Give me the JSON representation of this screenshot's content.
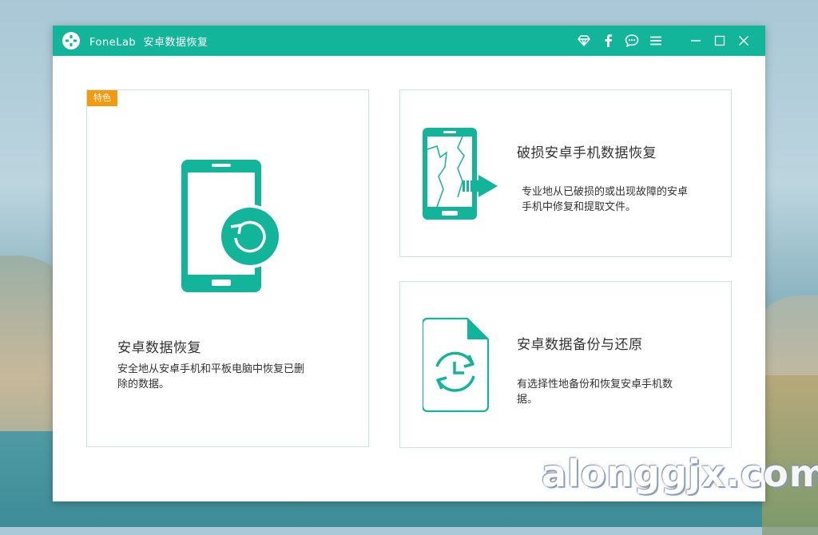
{
  "window": {
    "app_name": "FoneLab",
    "app_subtitle": "安卓数据恢复"
  },
  "titlebar_icons": [
    "diamond-icon",
    "facebook-icon",
    "chat-icon",
    "menu-icon",
    "minimize-icon",
    "maximize-icon",
    "close-icon"
  ],
  "cards": {
    "main": {
      "badge": "特色",
      "title": "安卓数据恢复",
      "desc_line1": "安全地从安卓手机和平板电脑中恢复已删",
      "desc_line2": "除的数据。"
    },
    "broken": {
      "title": "破损安卓手机数据恢复",
      "desc_line1": "专业地从已破损的或出现故障的安卓",
      "desc_line2": "手机中修复和提取文件。"
    },
    "backup": {
      "title": "安卓数据备份与还原",
      "desc_line1": "有选择性地备份和恢复安卓手机数",
      "desc_line2": "据。"
    }
  },
  "watermark": "alonggjx.com",
  "colors": {
    "accent": "#13b59a",
    "badge": "#f59a0c",
    "card_border": "#bfe8de"
  }
}
